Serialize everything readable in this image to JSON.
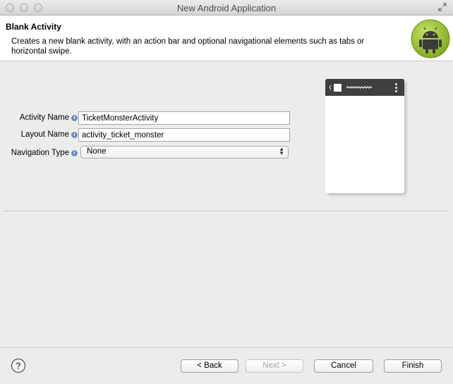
{
  "window": {
    "title": "New Android Application"
  },
  "header": {
    "title": "Blank Activity",
    "description": "Creates a new blank activity, with an action bar and optional navigational elements such as tabs or horizontal swipe."
  },
  "form": {
    "activity_name": {
      "label": "Activity Name",
      "value": "TicketMonsterActivity"
    },
    "layout_name": {
      "label": "Layout Name",
      "value": "activity_ticket_monster"
    },
    "navigation_type": {
      "label": "Navigation Type",
      "value": "None"
    }
  },
  "buttons": {
    "back": "< Back",
    "next": "Next >",
    "cancel": "Cancel",
    "finish": "Finish"
  },
  "icons": {
    "info": "info-icon",
    "help": "question-icon",
    "logo": "android-logo",
    "preview_back": "chevron-left-icon",
    "preview_menu": "overflow-menu-icon"
  },
  "colors": {
    "android_green": "#97c024",
    "header_bg": "#ffffff",
    "window_bg": "#ececec"
  }
}
